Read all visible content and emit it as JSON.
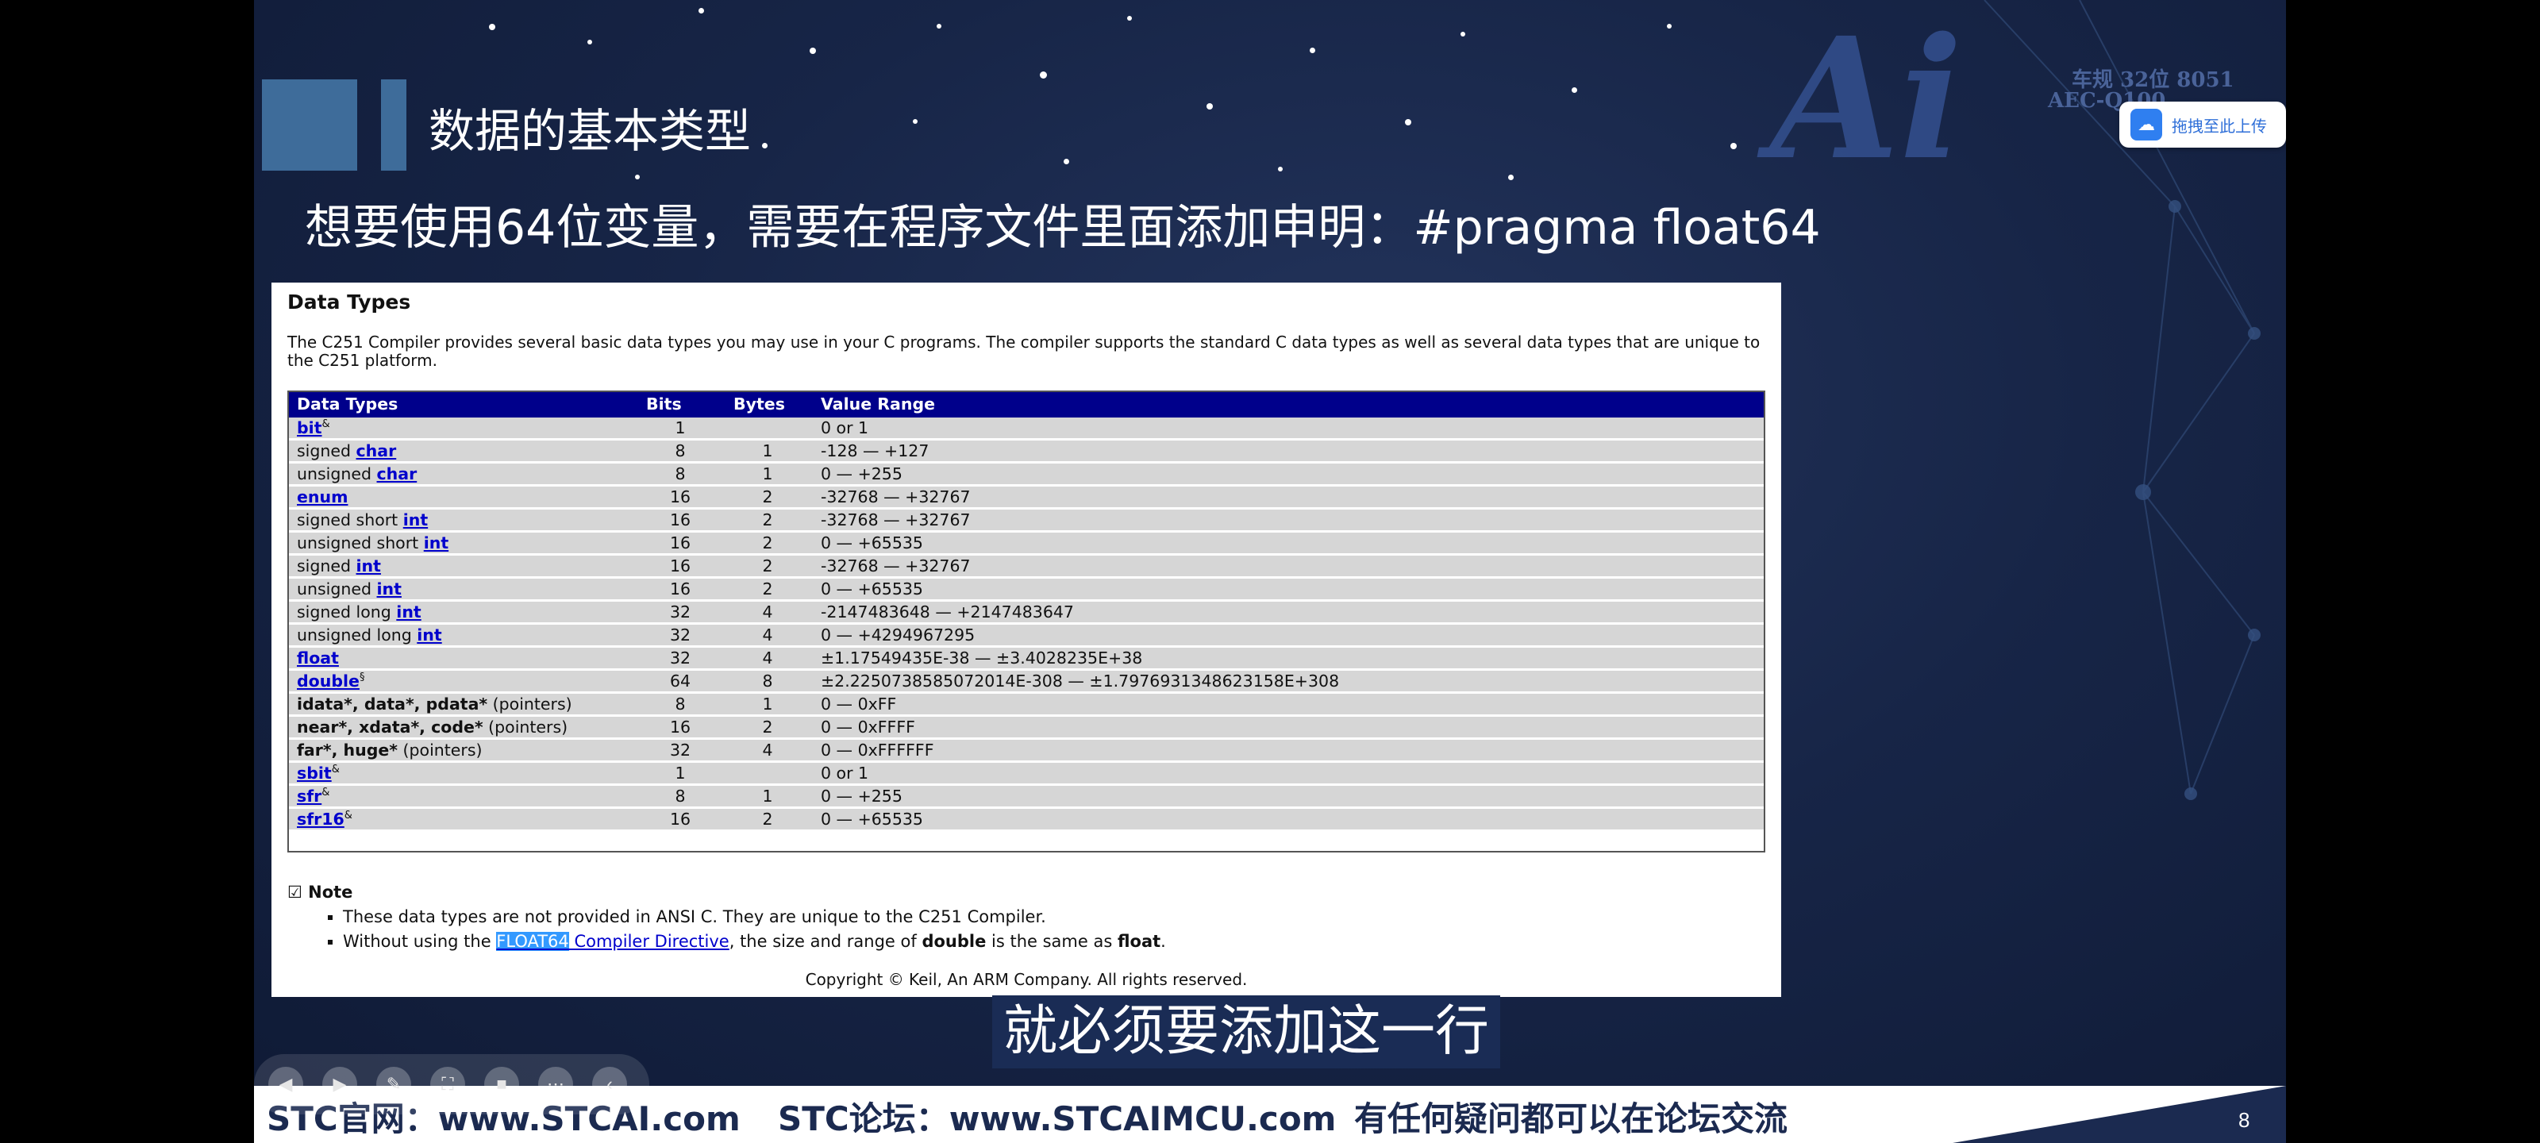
{
  "slide": {
    "title": "数据的基本类型",
    "subtitle": "想要使用64位变量，需要在程序文件里面添加申明：#pragma float64",
    "brand_ai": "Ai",
    "brand_line1": "车规 32位 8051",
    "brand_line2": "AEC-Q100",
    "upload_label": "拖拽至此上传",
    "caption": "就必须要添加这一行",
    "page_number": "8"
  },
  "doc": {
    "title": "Data Types",
    "intro": "The C251 Compiler provides several basic data types you may use in your C programs. The compiler supports the standard C data types as well as several data types that are unique to the C251 platform.",
    "headers": [
      "Data Types",
      "Bits",
      "Bytes",
      "Value Range"
    ],
    "rows": [
      {
        "pre": "",
        "kw": "bit",
        "sup": "&",
        "bits": "1",
        "bytes": "",
        "range": "0 or 1"
      },
      {
        "pre": "signed ",
        "kw": "char",
        "sup": "",
        "bits": "8",
        "bytes": "1",
        "range": "-128 — +127"
      },
      {
        "pre": "unsigned ",
        "kw": "char",
        "sup": "",
        "bits": "8",
        "bytes": "1",
        "range": "0 — +255"
      },
      {
        "pre": "",
        "kw": "enum",
        "sup": "",
        "bits": "16",
        "bytes": "2",
        "range": "-32768 — +32767"
      },
      {
        "pre": "signed short ",
        "kw": "int",
        "sup": "",
        "bits": "16",
        "bytes": "2",
        "range": "-32768 — +32767"
      },
      {
        "pre": "unsigned short ",
        "kw": "int",
        "sup": "",
        "bits": "16",
        "bytes": "2",
        "range": "0 — +65535"
      },
      {
        "pre": "signed ",
        "kw": "int",
        "sup": "",
        "bits": "16",
        "bytes": "2",
        "range": "-32768 — +32767"
      },
      {
        "pre": "unsigned ",
        "kw": "int",
        "sup": "",
        "bits": "16",
        "bytes": "2",
        "range": "0 — +65535"
      },
      {
        "pre": "signed long ",
        "kw": "int",
        "sup": "",
        "bits": "32",
        "bytes": "4",
        "range": "-2147483648 — +2147483647"
      },
      {
        "pre": "unsigned long ",
        "kw": "int",
        "sup": "",
        "bits": "32",
        "bytes": "4",
        "range": "0 — +4294967295"
      },
      {
        "pre": "",
        "kw": "float",
        "sup": "",
        "bits": "32",
        "bytes": "4",
        "range": "±1.17549435E-38 — ±3.4028235E+38"
      },
      {
        "pre": "",
        "kw": "double",
        "sup": "§",
        "bits": "64",
        "bytes": "8",
        "range": "±2.2250738585072014E-308 — ±1.7976931348623158E+308"
      }
    ],
    "ptr_rows": [
      {
        "bold": "idata*, data*, pdata*",
        "rest": " (pointers)",
        "bits": "8",
        "bytes": "1",
        "range": "0 — 0xFF"
      },
      {
        "bold": "near*, xdata*, code*",
        "rest": " (pointers)",
        "bits": "16",
        "bytes": "2",
        "range": "0 — 0xFFFF"
      },
      {
        "bold": "far*, huge*",
        "rest": " (pointers)",
        "bits": "32",
        "bytes": "4",
        "range": "0 — 0xFFFFFF"
      }
    ],
    "sfr_rows": [
      {
        "kw": "sbit",
        "sup": "&",
        "bits": "1",
        "bytes": "",
        "range": "0 or 1"
      },
      {
        "kw": "sfr",
        "sup": "&",
        "bits": "8",
        "bytes": "1",
        "range": "0 — +255"
      },
      {
        "kw": "sfr16",
        "sup": "&",
        "bits": "16",
        "bytes": "2",
        "range": "0 — +65535"
      }
    ],
    "note_title": "Note",
    "note1": "These data types are not provided in ANSI C. They are unique to the C251 Compiler.",
    "note2_pre": "Without using the ",
    "note2_hl": "FLOAT64",
    "note2_link": " Compiler Directive",
    "note2_mid": ", the size and range of ",
    "note2_b1": "double",
    "note2_mid2": " is the same as ",
    "note2_b2": "float",
    "note2_end": ".",
    "copyright": "Copyright © Keil, An ARM Company. All rights reserved."
  },
  "footer": {
    "site": "STC官网：www.STCAI.com",
    "forum": "STC论坛：www.STCAIMCU.com",
    "help": "有任何疑问都可以在论坛交流"
  },
  "player": {
    "icons": [
      "prev-icon",
      "next-icon",
      "pen-icon",
      "screenshot-icon",
      "camera-icon",
      "more-icon",
      "collapse-icon"
    ]
  }
}
